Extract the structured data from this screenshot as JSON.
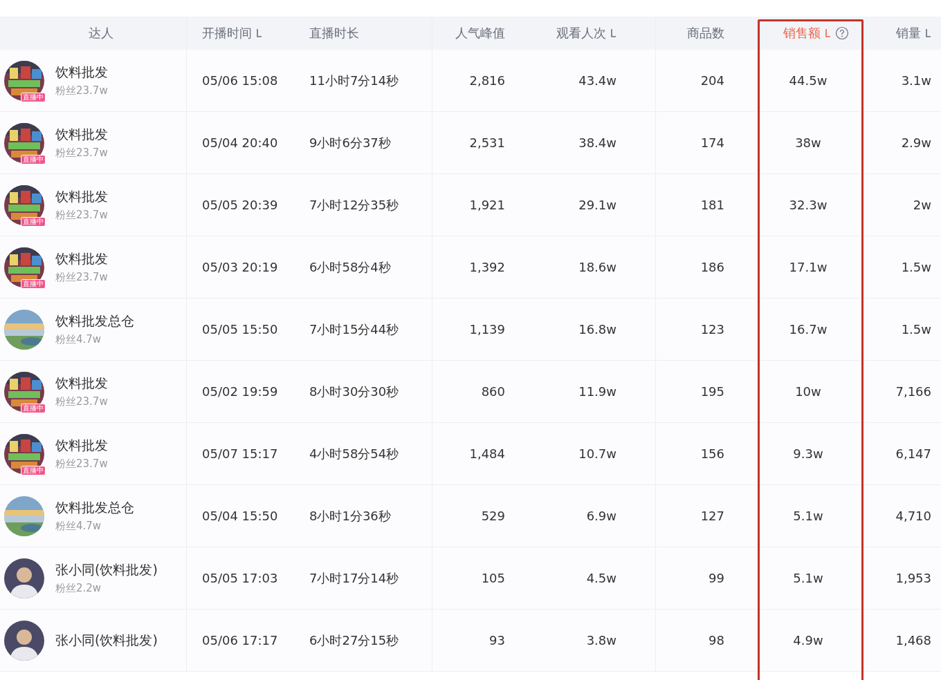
{
  "table": {
    "columns": [
      {
        "label": "达人",
        "sort_icon": false,
        "active": false,
        "help": false
      },
      {
        "label": "开播时间",
        "sort_icon": true,
        "active": false,
        "help": false
      },
      {
        "label": "直播时长",
        "sort_icon": false,
        "active": false,
        "help": false
      },
      {
        "label": "人气峰值",
        "sort_icon": false,
        "active": false,
        "help": false
      },
      {
        "label": "观看人次",
        "sort_icon": true,
        "active": false,
        "help": false
      },
      {
        "label": "商品数",
        "sort_icon": false,
        "active": false,
        "help": false
      },
      {
        "label": "销售额",
        "sort_icon": true,
        "active": true,
        "help": true
      },
      {
        "label": "销量",
        "sort_icon": true,
        "active": false,
        "help": false
      }
    ],
    "rows": [
      {
        "kind": "shop",
        "cells": [
          {
            "name": "饮料批发",
            "fans": "粉丝23.7w",
            "badge": "直播中"
          },
          "05/06 15:08",
          "11小时7分14秒",
          "2,816",
          "43.4w",
          "204",
          "44.5w",
          "3.1w"
        ]
      },
      {
        "kind": "shop",
        "cells": [
          {
            "name": "饮料批发",
            "fans": "粉丝23.7w",
            "badge": "直播中"
          },
          "05/04 20:40",
          "9小时6分37秒",
          "2,531",
          "38.4w",
          "174",
          "38w",
          "2.9w"
        ]
      },
      {
        "kind": "shop",
        "cells": [
          {
            "name": "饮料批发",
            "fans": "粉丝23.7w",
            "badge": "直播中"
          },
          "05/05 20:39",
          "7小时12分35秒",
          "1,921",
          "29.1w",
          "181",
          "32.3w",
          "2w"
        ]
      },
      {
        "kind": "shop",
        "cells": [
          {
            "name": "饮料批发",
            "fans": "粉丝23.7w",
            "badge": "直播中"
          },
          "05/03 20:19",
          "6小时58分4秒",
          "1,392",
          "18.6w",
          "186",
          "17.1w",
          "1.5w"
        ]
      },
      {
        "kind": "landscape",
        "cells": [
          {
            "name": "饮料批发总仓",
            "fans": "粉丝4.7w"
          },
          "05/05 15:50",
          "7小时15分44秒",
          "1,139",
          "16.8w",
          "123",
          "16.7w",
          "1.5w"
        ]
      },
      {
        "kind": "shop",
        "cells": [
          {
            "name": "饮料批发",
            "fans": "粉丝23.7w",
            "badge": "直播中"
          },
          "05/02 19:59",
          "8小时30分30秒",
          "860",
          "11.9w",
          "195",
          "10w",
          "7,166"
        ]
      },
      {
        "kind": "shop",
        "cells": [
          {
            "name": "饮料批发",
            "fans": "粉丝23.7w",
            "badge": "直播中"
          },
          "05/07 15:17",
          "4小时58分54秒",
          "1,484",
          "10.7w",
          "156",
          "9.3w",
          "6,147"
        ]
      },
      {
        "kind": "landscape",
        "cells": [
          {
            "name": "饮料批发总仓",
            "fans": "粉丝4.7w"
          },
          "05/04 15:50",
          "8小时1分36秒",
          "529",
          "6.9w",
          "127",
          "5.1w",
          "4,710"
        ]
      },
      {
        "kind": "person",
        "cells": [
          {
            "name": "张小同(饮料批发)",
            "fans": "粉丝2.2w"
          },
          "05/05 17:03",
          "7小时17分14秒",
          "105",
          "4.5w",
          "99",
          "5.1w",
          "1,953"
        ]
      },
      {
        "kind": "person",
        "cells": [
          {
            "name": "张小同(饮料批发)"
          },
          "05/06 17:17",
          "6小时27分15秒",
          "93",
          "3.8w",
          "98",
          "4.9w",
          "1,468"
        ]
      }
    ]
  }
}
